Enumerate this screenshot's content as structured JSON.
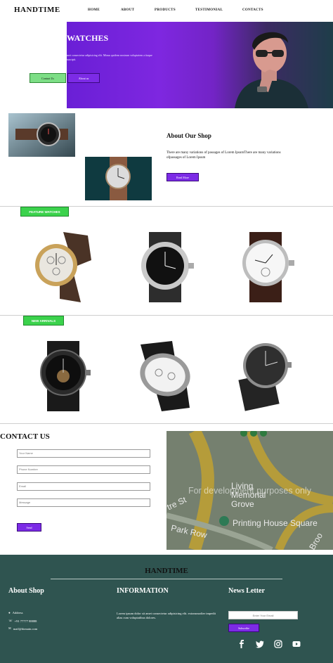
{
  "header": {
    "brand": "HANDTIME",
    "nav": [
      "HOME",
      "ABOUT",
      "PRODUCTS",
      "TESTIMONIAL",
      "CONTACTS"
    ]
  },
  "hero": {
    "title": "WATCHES",
    "text": "met consectetur adipisicing elit. Minus quidem nostrum voluptatem a itaque suscipit.",
    "contact_button": "Contact Us",
    "about_button": "About us",
    "gradient_start": "#6a1fd6",
    "gradient_end": "#1e3d49"
  },
  "about": {
    "title": "About Our Shop",
    "text": "There are many variations of passages of Lorem IpsumThere are many variations ofpassages of Lorem Ipsum",
    "button": "Read More"
  },
  "featured": {
    "label": "FEATURE  WATCHES",
    "items": [
      "gold-chronograph-watch",
      "black-dial-sport-watch",
      "silver-classic-leather-watch"
    ]
  },
  "arrivals": {
    "label": "NEW ARRIVALS",
    "items": [
      "black-skeleton-watch",
      "white-dial-chronograph",
      "round-smartwatch"
    ]
  },
  "contact": {
    "title": "CONTACT US",
    "fields": {
      "name": "Your Name",
      "phone": "Phone Number",
      "email": "Email",
      "message": "Message"
    },
    "send": "Send",
    "map": {
      "watermark": "For development purposes only",
      "labels": [
        "Living",
        "Memorial",
        "Grove",
        "Printing House Square",
        "Park Row",
        "Broo",
        "tre St"
      ]
    }
  },
  "footer": {
    "brand": "HANDTIME",
    "about_title": "About Shop",
    "address": "Address",
    "phone": "+91 77777 88888",
    "email": "mail@domain.com",
    "info_title": "INFORMATION",
    "info_text": "Lorem ipsum dolor sit amet consectetur adipisicing elit. extonsmodier impedit alias cum voluptatibus dolores.",
    "news_title": "News Letter",
    "email_placeholder": "Enter Your Email",
    "subscribe": "Subscribe",
    "socials": [
      "facebook-icon",
      "twitter-icon",
      "instagram-icon",
      "youtube-icon"
    ],
    "background": "#2f5450"
  },
  "colors": {
    "accent_purple": "#7c2be6",
    "accent_green": "#3bd24c"
  }
}
